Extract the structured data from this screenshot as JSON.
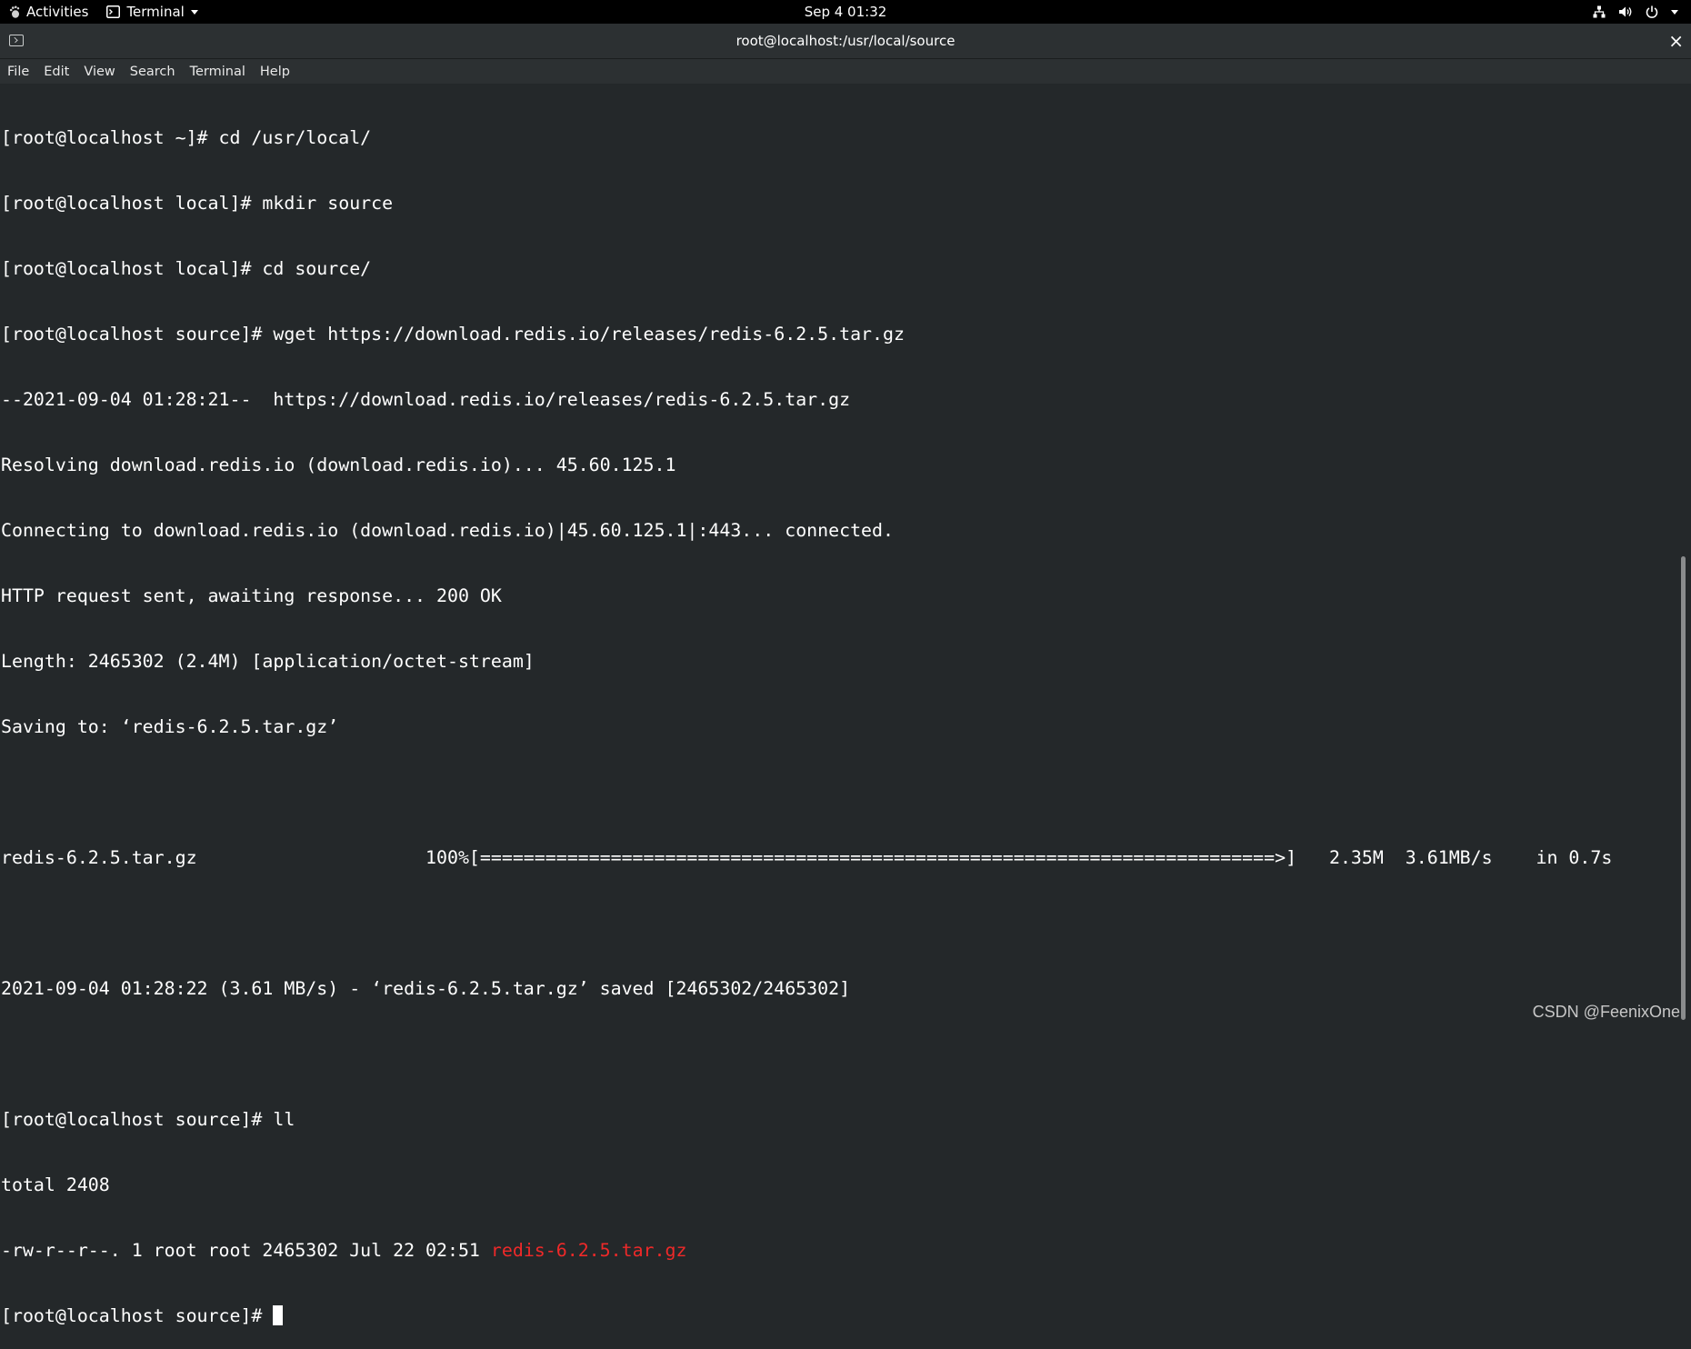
{
  "topbar": {
    "activities": "Activities",
    "app_name": "Terminal",
    "clock": "Sep 4  01:32"
  },
  "window": {
    "title": "root@localhost:/usr/local/source",
    "close_glyph": "×"
  },
  "menu": {
    "items": [
      "File",
      "Edit",
      "View",
      "Search",
      "Terminal",
      "Help"
    ]
  },
  "terminal": {
    "lines": [
      "[root@localhost ~]# cd /usr/local/",
      "[root@localhost local]# mkdir source",
      "[root@localhost local]# cd source/",
      "[root@localhost source]# wget https://download.redis.io/releases/redis-6.2.5.tar.gz",
      "--2021-09-04 01:28:21--  https://download.redis.io/releases/redis-6.2.5.tar.gz",
      "Resolving download.redis.io (download.redis.io)... 45.60.125.1",
      "Connecting to download.redis.io (download.redis.io)|45.60.125.1|:443... connected.",
      "HTTP request sent, awaiting response... 200 OK",
      "Length: 2465302 (2.4M) [application/octet-stream]",
      "Saving to: ‘redis-6.2.5.tar.gz’",
      "",
      "redis-6.2.5.tar.gz                     100%[=========================================================================>]   2.35M  3.61MB/s    in 0.7s",
      "",
      "2021-09-04 01:28:22 (3.61 MB/s) - ‘redis-6.2.5.tar.gz’ saved [2465302/2465302]",
      "",
      "[root@localhost source]# ll",
      "total 2408"
    ],
    "ls_line_prefix": "-rw-r--r--. 1 root root 2465302 Jul 22 02:51 ",
    "ls_line_filename": "redis-6.2.5.tar.gz",
    "prompt": "[root@localhost source]# "
  },
  "watermark": "CSDN @FeenixOne",
  "colors": {
    "terminal_bg": "#24282a",
    "archive_red": "#ef2929",
    "topbar_bg": "#000000"
  },
  "icons": {
    "activities": "gnome-foot-icon",
    "app": "terminal-icon",
    "network": "network-icon",
    "volume": "volume-icon",
    "power": "power-icon"
  }
}
